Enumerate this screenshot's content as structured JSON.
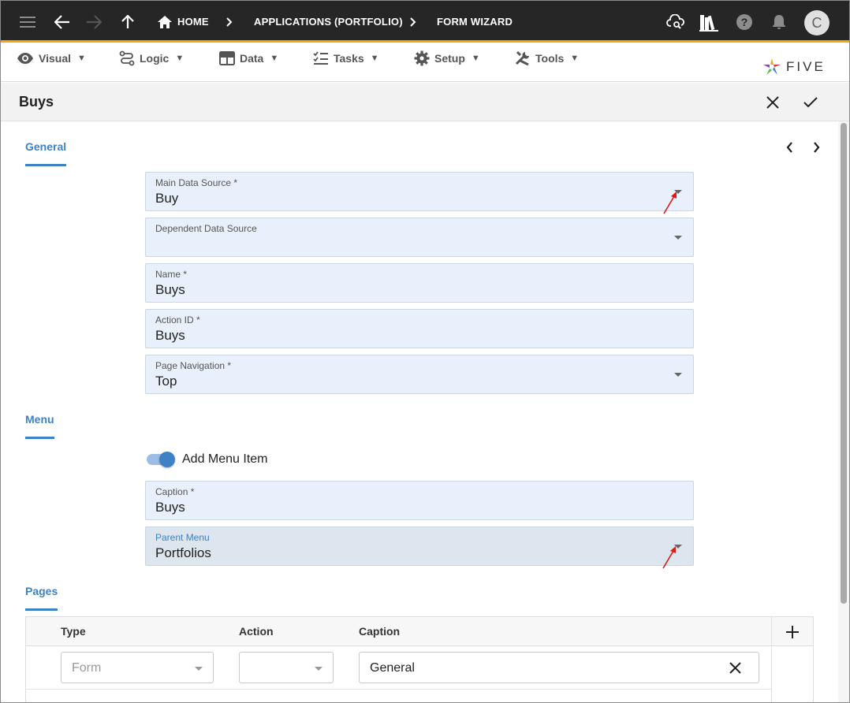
{
  "topbar": {
    "breadcrumbs": [
      "HOME",
      "APPLICATIONS (PORTFOLIO)",
      "FORM WIZARD"
    ],
    "avatar_letter": "C",
    "icons": [
      "menu-icon",
      "back-icon",
      "forward-icon",
      "up-icon",
      "home-icon",
      "cloud-search-icon",
      "library-icon",
      "help-icon",
      "bell-icon"
    ]
  },
  "menubar": {
    "items": [
      "Visual",
      "Logic",
      "Data",
      "Tasks",
      "Setup",
      "Tools"
    ],
    "logo": "FIVE"
  },
  "form": {
    "title": "Buys",
    "sections": {
      "general": "General",
      "menu": "Menu",
      "pages": "Pages"
    },
    "fields": {
      "main_data_source": {
        "label": "Main Data Source *",
        "value": "Buy"
      },
      "dependent_data_source": {
        "label": "Dependent Data Source",
        "value": ""
      },
      "name": {
        "label": "Name *",
        "value": "Buys"
      },
      "action_id": {
        "label": "Action ID *",
        "value": "Buys"
      },
      "page_navigation": {
        "label": "Page Navigation *",
        "value": "Top"
      },
      "caption": {
        "label": "Caption *",
        "value": "Buys"
      },
      "parent_menu": {
        "label": "Parent Menu",
        "value": "Portfolios"
      }
    },
    "add_menu_item": {
      "label": "Add Menu Item",
      "checked": true
    },
    "pages_table": {
      "columns": [
        "Type",
        "Action",
        "Caption"
      ],
      "rows": [
        {
          "type": "Form",
          "action": "",
          "caption": "General"
        }
      ]
    }
  },
  "colors": {
    "topbar_bg": "#262626",
    "accent_orange": "#f3a712",
    "link_blue": "#3d82c4",
    "field_bg": "#e8f0fb",
    "annotation_red": "#e01a1a"
  }
}
